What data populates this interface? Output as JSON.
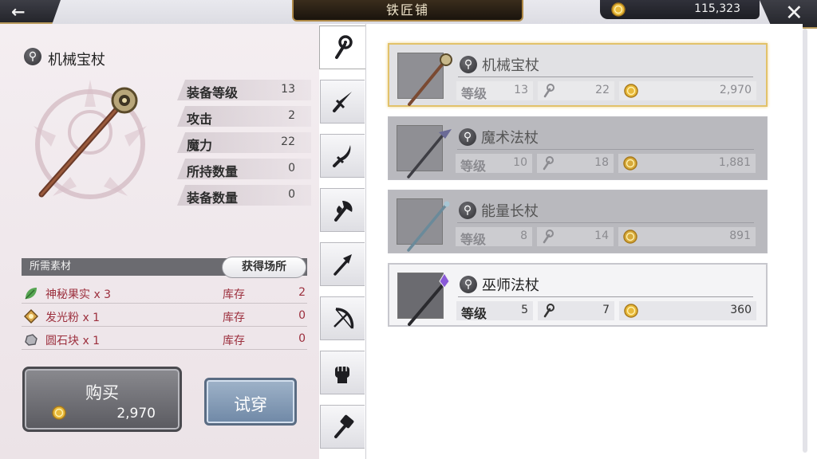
{
  "header": {
    "title": "铁匠铺",
    "gold": "115,323",
    "back_icon": "left-arrow-icon",
    "close_icon": "close-icon"
  },
  "item": {
    "name": "机械宝杖",
    "stats": [
      {
        "label": "装备等级",
        "value": "13"
      },
      {
        "label": "攻击",
        "value": "2"
      },
      {
        "label": "魔力",
        "value": "22"
      },
      {
        "label": "所持数量",
        "value": "0"
      },
      {
        "label": "装备数量",
        "value": "0"
      }
    ]
  },
  "materials": {
    "header": "所需素材",
    "source_button": "获得场所",
    "items": [
      {
        "name": "神秘果实 x 3",
        "stock_label": "库存",
        "stock": "2",
        "icon": "leaf-icon"
      },
      {
        "name": "发光粉 x 1",
        "stock_label": "库存",
        "stock": "0",
        "icon": "powder-icon"
      },
      {
        "name": "圆石块 x 1",
        "stock_label": "库存",
        "stock": "0",
        "icon": "stone-icon"
      }
    ]
  },
  "actions": {
    "buy_label": "购买",
    "buy_price": "2,970",
    "try_label": "试穿"
  },
  "tabs": [
    {
      "name": "staff",
      "icon": "staff-icon",
      "active": true
    },
    {
      "name": "sword",
      "icon": "sword-icon",
      "active": false
    },
    {
      "name": "blade",
      "icon": "blade-icon",
      "active": false
    },
    {
      "name": "axe",
      "icon": "axe-icon",
      "active": false
    },
    {
      "name": "spear",
      "icon": "spear-icon",
      "active": false
    },
    {
      "name": "bow",
      "icon": "bow-icon",
      "active": false
    },
    {
      "name": "gauntlet",
      "icon": "gauntlet-icon",
      "active": false
    },
    {
      "name": "hammer",
      "icon": "hammer-icon",
      "active": false
    }
  ],
  "shop_list": [
    {
      "name": "机械宝杖",
      "level_label": "等级",
      "level": "13",
      "magic": "22",
      "price": "2,970",
      "state": "selected"
    },
    {
      "name": "魔术法杖",
      "level_label": "等级",
      "level": "10",
      "magic": "18",
      "price": "1,881",
      "state": "locked"
    },
    {
      "name": "能量长杖",
      "level_label": "等级",
      "level": "8",
      "magic": "14",
      "price": "891",
      "state": "locked"
    },
    {
      "name": "巫师法杖",
      "level_label": "等级",
      "level": "5",
      "magic": "7",
      "price": "360",
      "state": "owned"
    }
  ],
  "colors": {
    "accent_gold": "#e2c26a",
    "material_text": "#9c2f3d",
    "panel_bg": "#f4eef1"
  }
}
